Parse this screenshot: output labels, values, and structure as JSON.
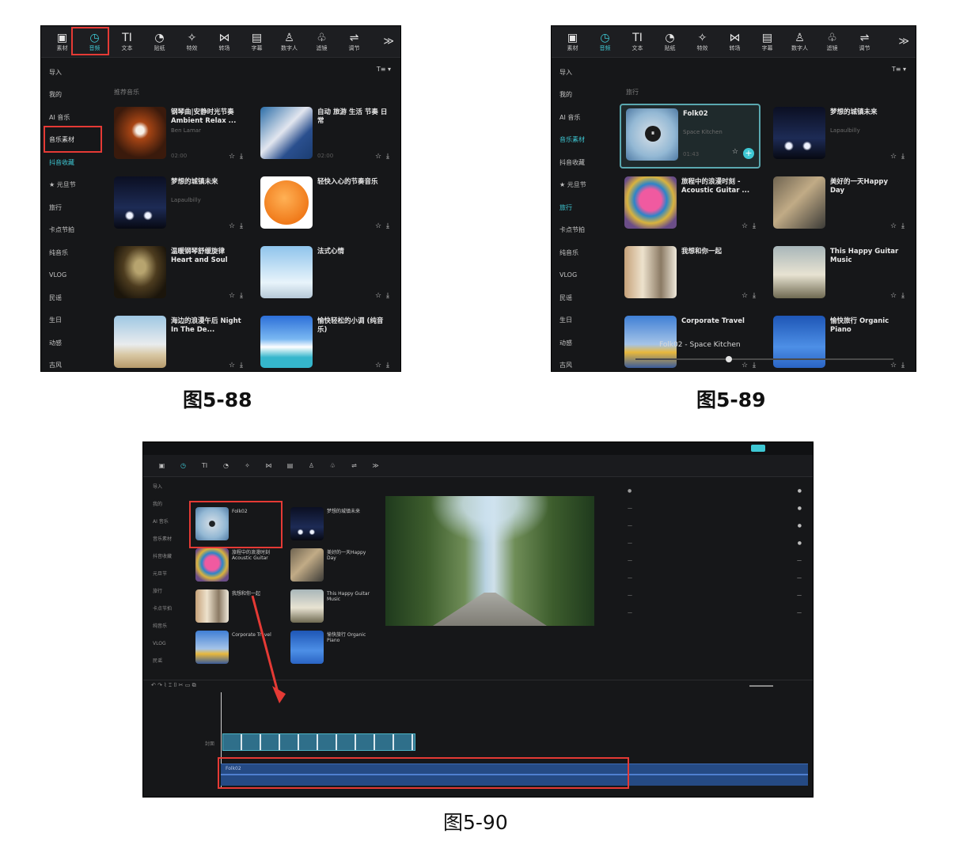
{
  "captions": {
    "fig88": "图5-88",
    "fig89": "图5-89",
    "fig90": "图5-90"
  },
  "toolbar": {
    "items": [
      {
        "icon": "media-icon",
        "glyph": "▣",
        "label": "素材"
      },
      {
        "icon": "audio-icon",
        "glyph": "◷",
        "label": "音频"
      },
      {
        "icon": "text-icon",
        "glyph": "TI",
        "label": "文本"
      },
      {
        "icon": "sticker-icon",
        "glyph": "◔",
        "label": "贴纸"
      },
      {
        "icon": "effects-icon",
        "glyph": "✧",
        "label": "特效"
      },
      {
        "icon": "transition-icon",
        "glyph": "⋈",
        "label": "转场"
      },
      {
        "icon": "captions-icon",
        "glyph": "▤",
        "label": "字幕"
      },
      {
        "icon": "digital-human-icon",
        "glyph": "♙",
        "label": "数字人"
      },
      {
        "icon": "filter-icon",
        "glyph": "♧",
        "label": "滤镜"
      },
      {
        "icon": "adjust-icon",
        "glyph": "⇌",
        "label": "调节"
      }
    ],
    "more": "≫"
  },
  "fig88": {
    "sidebar": [
      "导入",
      "我的",
      "AI 音乐",
      "音乐素材",
      "抖音收藏",
      "★ 元旦节",
      "旅行",
      "卡点节拍",
      "纯音乐",
      "VLOG",
      "民谣",
      "生日",
      "动感",
      "古风"
    ],
    "subhead": "推荐音乐",
    "filter": "T≡ ▾",
    "songs": [
      {
        "title": "钢琴曲|安静时光节奏 Ambient Relax ...",
        "artist": "Ben Lamar",
        "duration": "02:00",
        "thumb": "t-flower"
      },
      {
        "title": "自动 旅游 生活 节奏 日常",
        "artist": "",
        "duration": "02:00",
        "thumb": "t-city"
      },
      {
        "title": "梦想的城镇未来",
        "artist": "Lapaulbilly",
        "duration": "",
        "thumb": "t-car"
      },
      {
        "title": "轻快入心的节奏音乐",
        "artist": "",
        "duration": "",
        "thumb": "t-orange"
      },
      {
        "title": "温暖钢琴舒缓旋律 Heart and Soul",
        "artist": "",
        "duration": "",
        "thumb": "t-tree"
      },
      {
        "title": "法式心情",
        "artist": "",
        "duration": "",
        "thumb": "t-tower"
      },
      {
        "title": "海边的浪漫午后 Night In The De...",
        "artist": "",
        "duration": "",
        "thumb": "t-beach"
      },
      {
        "title": "愉快轻松的小调 (纯音乐)",
        "artist": "",
        "duration": "",
        "thumb": "t-sky"
      }
    ]
  },
  "fig89": {
    "sidebar": [
      "导入",
      "我的",
      "AI 音乐",
      "音乐素材",
      "抖音收藏",
      "★ 元旦节",
      "旅行",
      "卡点节拍",
      "纯音乐",
      "VLOG",
      "民谣",
      "生日",
      "动感",
      "古风"
    ],
    "subhead": "旅行",
    "filter": "T≡ ▾",
    "songs": [
      {
        "title": "Folk02",
        "artist": "Space Kitchen",
        "duration": "01:43",
        "thumb": "t-folk",
        "playing": true
      },
      {
        "title": "梦想的城镇未来",
        "artist": "Lapaulbilly",
        "duration": "",
        "thumb": "t-car"
      },
      {
        "title": "旅程中的浪漫时刻 - Acoustic Guitar ...",
        "artist": "",
        "duration": "",
        "thumb": "t-pink"
      },
      {
        "title": "美好的一天Happy Day",
        "artist": "",
        "duration": "",
        "thumb": "t-room"
      },
      {
        "title": "我想和你一起",
        "artist": "",
        "duration": "",
        "thumb": "t-cafe"
      },
      {
        "title": "This Happy Guitar Music",
        "artist": "",
        "duration": "",
        "thumb": "t-bird"
      },
      {
        "title": "Corporate Travel",
        "artist": "",
        "duration": "",
        "thumb": "t-sun"
      },
      {
        "title": "愉快旅行 Organic Piano",
        "artist": "",
        "duration": "",
        "thumb": "t-blue"
      }
    ],
    "now_playing": "Folk02 - Space Kitchen"
  },
  "fig90": {
    "tools": [
      "▣",
      "◷",
      "TI",
      "◔",
      "✧",
      "⋈",
      "▤",
      "♙",
      "♧",
      "⇌",
      "≫"
    ],
    "sidebar": [
      "导入",
      "我的",
      "AI 音乐",
      "音乐素材",
      "抖音收藏",
      "元旦节",
      "旅行",
      "卡点节拍",
      "纯音乐",
      "VLOG",
      "民谣"
    ],
    "songs": [
      {
        "title": "Folk02",
        "thumb": "t-folk"
      },
      {
        "title": "梦想的城镇未来",
        "thumb": "t-car"
      },
      {
        "title": "旅程中的浪漫时刻 Acoustic Guitar",
        "thumb": "t-pink"
      },
      {
        "title": "美好的一天Happy Day",
        "thumb": "t-room"
      },
      {
        "title": "我想和你一起",
        "thumb": "t-cafe"
      },
      {
        "title": "This Happy Guitar Music",
        "thumb": "t-bird"
      },
      {
        "title": "Corporate Travel",
        "thumb": "t-sun"
      },
      {
        "title": "愉快旅行 Organic Piano",
        "thumb": "t-blue"
      }
    ],
    "audio_clip": "Folk02",
    "video_label": "封面"
  }
}
